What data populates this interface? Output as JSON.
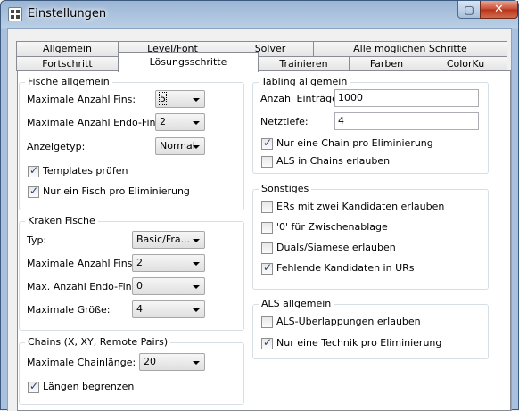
{
  "window": {
    "title": "Einstellungen"
  },
  "titlebar_buttons": {
    "close_label": "✕",
    "maximize_label": "▢"
  },
  "tabs_row1": [
    "Allgemein",
    "Level/Font",
    "Solver",
    "Alle möglichen Schritte"
  ],
  "tabs_row2": [
    "Fortschritt",
    "Lösungsschritte",
    "Trainieren",
    "Farben",
    "ColorKu"
  ],
  "active_tab": "Lösungsschritte",
  "fische_allgemein": {
    "title": "Fische allgemein",
    "max_fins_label": "Maximale Anzahl Fins:",
    "max_fins_value": "5",
    "max_endo_fins_label": "Maximale Anzahl Endo-Fins:",
    "max_endo_fins_value": "2",
    "anzeigetyp_label": "Anzeigetyp:",
    "anzeigetyp_value": "Normal",
    "templates_label": "Templates prüfen",
    "templates_checked": true,
    "ein_fisch_label": "Nur ein Fisch pro Eliminierung",
    "ein_fisch_checked": true
  },
  "kraken_fische": {
    "title": "Kraken Fische",
    "typ_label": "Typ:",
    "typ_value": "Basic/Fra...",
    "max_fins_label": "Maximale Anzahl Fins:",
    "max_fins_value": "2",
    "max_endo_label": "Max. Anzahl Endo-Fins:",
    "max_endo_value": "0",
    "max_groesse_label": "Maximale Größe:",
    "max_groesse_value": "4"
  },
  "chains": {
    "title": "Chains (X, XY, Remote Pairs)",
    "max_laenge_label": "Maximale Chainlänge:",
    "max_laenge_value": "20",
    "laengen_label": "Längen begrenzen",
    "laengen_checked": true
  },
  "tabling": {
    "title": "Tabling allgemein",
    "anzahl_label": "Anzahl Einträge:",
    "anzahl_value": "1000",
    "netztiefe_label": "Netztiefe:",
    "netztiefe_value": "4",
    "eine_chain_label": "Nur eine Chain pro Eliminierung",
    "eine_chain_checked": true,
    "als_chains_label": "ALS in Chains erlauben",
    "als_chains_checked": false
  },
  "sonstiges": {
    "title": "Sonstiges",
    "ers_label": "ERs mit zwei Kandidaten erlauben",
    "ers_checked": false,
    "null_label": "'0' für Zwischenablage",
    "null_checked": false,
    "duals_label": "Duals/Siamese erlauben",
    "duals_checked": false,
    "fehlende_label": "Fehlende Kandidaten in URs",
    "fehlende_checked": true
  },
  "als_allgemein": {
    "title": "ALS allgemein",
    "ueberlappung_label": "ALS-Überlappungen erlauben",
    "ueberlappung_checked": false,
    "technik_label": "Nur eine Technik pro Eliminierung",
    "technik_checked": true
  }
}
